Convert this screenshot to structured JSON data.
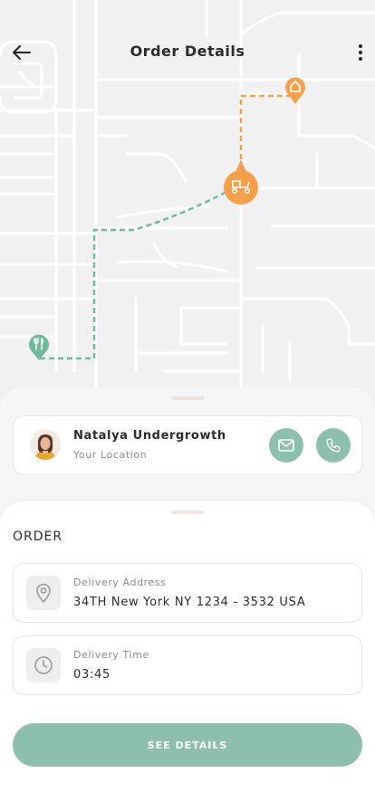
{
  "header": {
    "title": "Order Details",
    "back_icon": "arrow-left-icon",
    "more_icon": "more-vertical-icon"
  },
  "map": {
    "destination_icon": "home-pin-icon",
    "courier_icon": "scooter-pin-icon",
    "origin_icon": "restaurant-pin-icon"
  },
  "user": {
    "name": "Natalya Undergrowth",
    "subtitle": "Your Location",
    "mail_icon": "mail-icon",
    "phone_icon": "phone-icon"
  },
  "order": {
    "heading": "ORDER",
    "address_label": "Delivery Address",
    "address_value": "34TH New York NY 1234 - 3532 USA",
    "time_label": "Delivery Time",
    "time_value": "03:45"
  },
  "cta_label": "SEE DETAILS",
  "colors": {
    "accent_green": "#8cc0ad",
    "accent_orange": "#f4a04b",
    "map_background": "#f1f1f3"
  }
}
